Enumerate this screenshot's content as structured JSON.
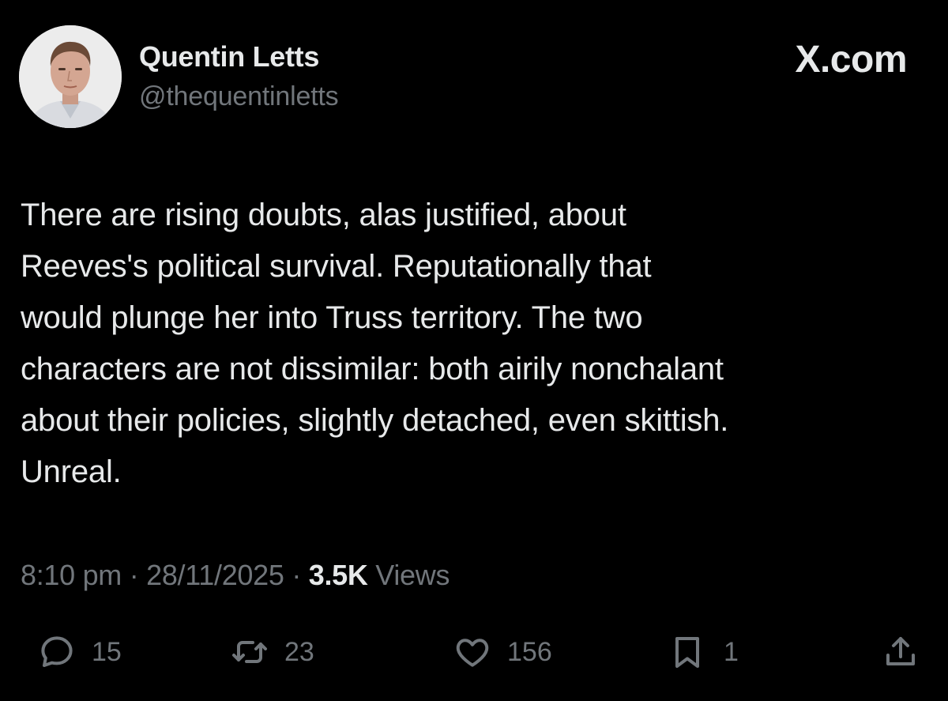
{
  "author": {
    "display_name": "Quentin Letts",
    "handle": "@thequentinletts"
  },
  "brand": "X.com",
  "tweet": {
    "text": "There are rising doubts, alas justified, about\nReeves's  political survival. Reputationally that\nwould plunge her into Truss territory. The two\ncharacters are not dissimilar: both airily nonchalant\nabout their policies, slightly detached, even skittish.\nUnreal."
  },
  "meta": {
    "time": "8:10 pm",
    "separator": "·",
    "date": "28/11/2025",
    "views_count": "3.5K",
    "views_label": "Views"
  },
  "actions": {
    "replies": "15",
    "reposts": "23",
    "likes": "156",
    "bookmarks": "1"
  },
  "icons": {
    "reply": "speech-bubble-icon",
    "repost": "repost-arrows-icon",
    "like": "heart-icon",
    "bookmark": "bookmark-icon",
    "share": "share-upload-icon"
  },
  "colors": {
    "background": "#000000",
    "primary_text": "#e7e9ea",
    "secondary_text": "#71767b"
  }
}
